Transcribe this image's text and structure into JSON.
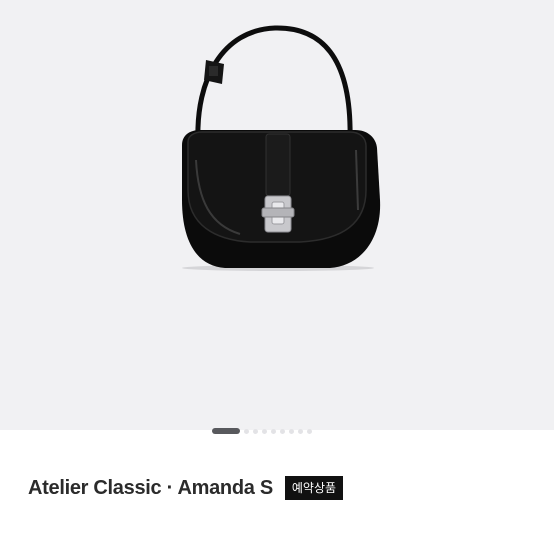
{
  "product": {
    "title": "Atelier Classic · Amanda S",
    "badge": "예약상품",
    "image_icon": "handbag-image"
  },
  "carousel": {
    "slide_count": 9,
    "active_index": 0
  },
  "colors": {
    "image_background": "#f1f1f3",
    "badge_background": "#111111",
    "active_dot": "#58595d"
  }
}
